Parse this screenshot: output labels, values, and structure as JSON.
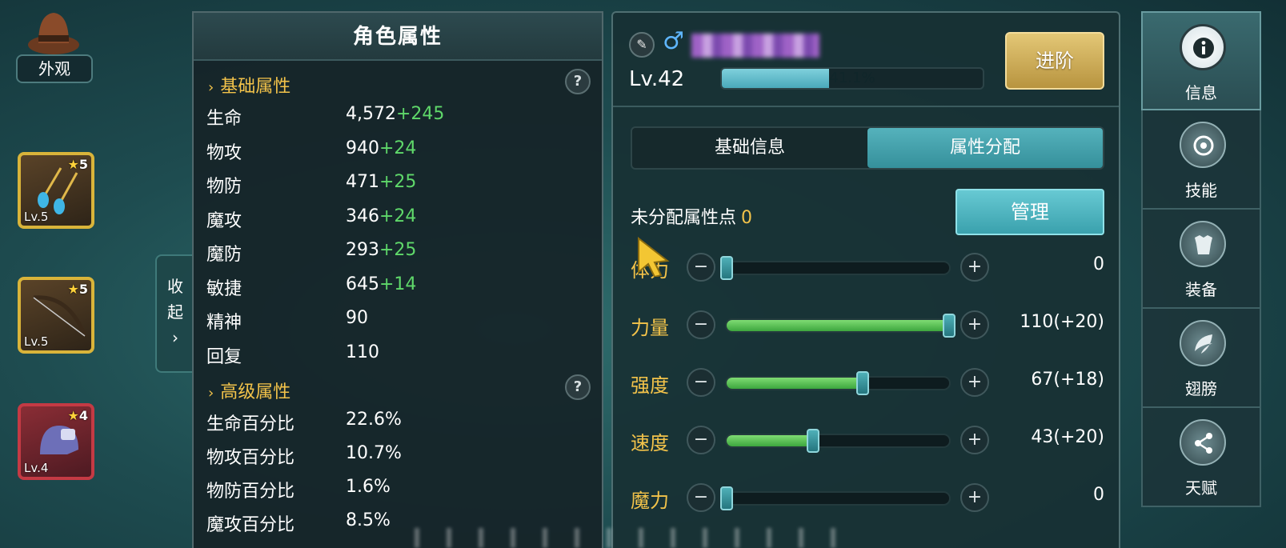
{
  "left_column": {
    "appearance_label": "外观",
    "equipment_slots": [
      {
        "stars": "5",
        "level": "Lv.5",
        "rarity": "gold",
        "icon": "earring-icon"
      },
      {
        "stars": "5",
        "level": "Lv.5",
        "rarity": "gold",
        "icon": "bow-icon"
      },
      {
        "stars": "4",
        "level": "Lv.4",
        "rarity": "red",
        "icon": "helmet-icon"
      }
    ],
    "collapse_label_1": "收",
    "collapse_label_2": "起",
    "collapse_chevron": "›"
  },
  "attr_panel": {
    "title": "角色属性",
    "basic_section": "基础属性",
    "advanced_section": "高级属性",
    "help_symbol": "?",
    "basic": [
      {
        "name": "生命",
        "value": "4,572",
        "bonus": "+245"
      },
      {
        "name": "物攻",
        "value": "940",
        "bonus": "+24"
      },
      {
        "name": "物防",
        "value": "471",
        "bonus": "+25"
      },
      {
        "name": "魔攻",
        "value": "346",
        "bonus": "+24"
      },
      {
        "name": "魔防",
        "value": "293",
        "bonus": "+25"
      },
      {
        "name": "敏捷",
        "value": "645",
        "bonus": "+14"
      },
      {
        "name": "精神",
        "value": "90",
        "bonus": ""
      },
      {
        "name": "回复",
        "value": "110",
        "bonus": ""
      }
    ],
    "advanced": [
      {
        "name": "生命百分比",
        "value": "22.6%"
      },
      {
        "name": "物攻百分比",
        "value": "10.7%"
      },
      {
        "name": "物防百分比",
        "value": "1.6%"
      },
      {
        "name": "魔攻百分比",
        "value": "8.5%"
      }
    ]
  },
  "info_panel": {
    "edit_icon": "✎",
    "gender_symbol": "♂",
    "level": "Lv.42",
    "exp_percent_text": "41.1%",
    "exp_fraction": 0.411,
    "advance_button": "进阶",
    "tabs": [
      {
        "label": "基础信息",
        "active": false
      },
      {
        "label": "属性分配",
        "active": true
      }
    ],
    "unallocated_label": "未分配属性点",
    "unallocated_value": "0",
    "manage_button": "管理",
    "minus_symbol": "−",
    "plus_symbol": "+",
    "stats": [
      {
        "name": "体力",
        "value": "0",
        "fraction": 0.0
      },
      {
        "name": "力量",
        "value": "110(+20)",
        "fraction": 1.0
      },
      {
        "name": "强度",
        "value": "67(+18)",
        "fraction": 0.61
      },
      {
        "name": "速度",
        "value": "43(+20)",
        "fraction": 0.39
      },
      {
        "name": "魔力",
        "value": "0",
        "fraction": 0.0
      }
    ]
  },
  "sidebar": {
    "items": [
      {
        "label": "信息",
        "icon": "info-icon",
        "active": true
      },
      {
        "label": "技能",
        "icon": "skill-icon",
        "active": false
      },
      {
        "label": "装备",
        "icon": "armor-icon",
        "active": false
      },
      {
        "label": "翅膀",
        "icon": "wing-icon",
        "active": false
      },
      {
        "label": "天赋",
        "icon": "share-icon",
        "active": false
      }
    ]
  },
  "colors": {
    "bonus_green": "#5fd86a",
    "gold_text": "#f3c34a",
    "accent_teal": "#3aa1ad",
    "advance_gold": "#c9a550"
  }
}
